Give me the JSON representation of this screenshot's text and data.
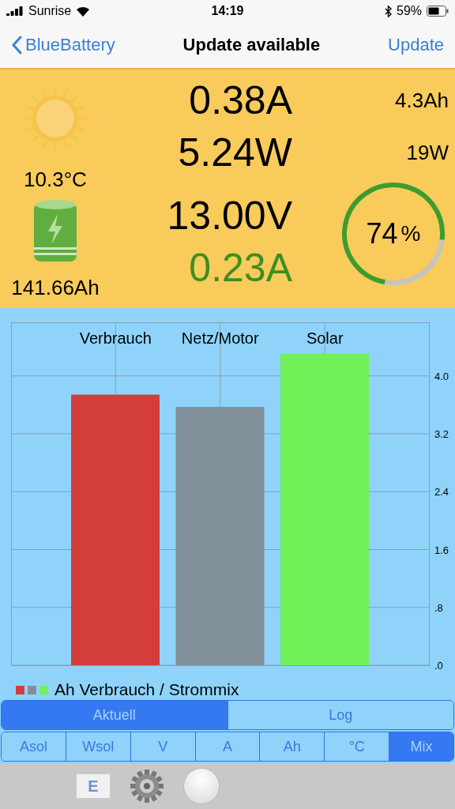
{
  "status_bar": {
    "carrier": "Sunrise",
    "time": "14:19",
    "battery": "59%"
  },
  "nav": {
    "back": "BlueBattery",
    "title": "Update available",
    "action": "Update"
  },
  "summary": {
    "temperature": "10.3°C",
    "capacity": "141.66Ah",
    "readings": [
      {
        "value": "0.38A",
        "color": "#000000"
      },
      {
        "value": "5.24W",
        "color": "#000000"
      },
      {
        "value": "13.00V",
        "color": "#000000"
      },
      {
        "value": "0.23A",
        "color": "#3c8f22"
      }
    ],
    "side": [
      "4.3Ah",
      "19W"
    ],
    "gauge": {
      "level": 0.74,
      "value": "74",
      "unit": "%"
    }
  },
  "chart": {
    "legend": "Ah Verbrauch / Strommix",
    "chart_data": {
      "type": "bar",
      "grid": true,
      "stacked": true,
      "categories": [
        "Verbrauch",
        "Netz/Motor",
        "Solar"
      ],
      "ylim": [
        0,
        4.74
      ],
      "yticks": [
        {
          "value": 0,
          "label": ".0"
        },
        {
          "value": 0.8,
          "label": ".8"
        },
        {
          "value": 1.6,
          "label": "1.6"
        },
        {
          "value": 2.4,
          "label": "2.4"
        },
        {
          "value": 3.2,
          "label": "3.2"
        },
        {
          "value": 4.0,
          "label": "4.0"
        }
      ],
      "series": [
        {
          "color": "#d33d3a",
          "values": [
            3.74,
            null,
            null
          ]
        },
        {
          "color": "#818f99",
          "values": [
            null,
            3.57,
            null
          ]
        },
        {
          "color": "#72f057",
          "values": [
            null,
            null,
            4.31
          ]
        }
      ]
    }
  },
  "views": [
    {
      "label": "Aktuell",
      "selected": true
    },
    {
      "label": "Log",
      "selected": false
    }
  ],
  "units": [
    {
      "label": "Asol",
      "selected": false
    },
    {
      "label": "Wsol",
      "selected": false
    },
    {
      "label": "V",
      "selected": false
    },
    {
      "label": "A",
      "selected": false
    },
    {
      "label": "Ah",
      "selected": false
    },
    {
      "label": "°C",
      "selected": false
    },
    {
      "label": "Mix",
      "selected": true
    }
  ],
  "toolbar": {
    "mail_letter": "E"
  }
}
